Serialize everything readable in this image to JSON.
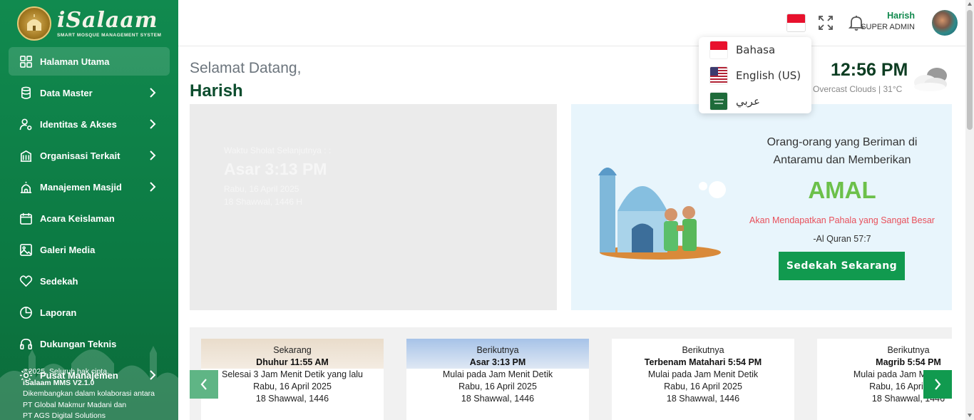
{
  "brand": {
    "name": "iSalaam",
    "subtitle": "SMART MOSQUE MANAGEMENT SYSTEM"
  },
  "sidebar": {
    "items": [
      {
        "label": "Halaman Utama",
        "icon": "grid-icon"
      },
      {
        "label": "Data Master",
        "icon": "database-icon"
      },
      {
        "label": "Identitas & Akses",
        "icon": "user-gear-icon"
      },
      {
        "label": "Organisasi Terkait",
        "icon": "building-icon"
      },
      {
        "label": "Manajemen Masjid",
        "icon": "mosque-icon"
      },
      {
        "label": "Acara Keislaman",
        "icon": "calendar-icon"
      },
      {
        "label": "Galeri Media",
        "icon": "image-icon"
      },
      {
        "label": "Sedekah",
        "icon": "heart-icon"
      },
      {
        "label": "Laporan",
        "icon": "pie-chart-icon"
      },
      {
        "label": "Dukungan Teknis",
        "icon": "headset-icon"
      },
      {
        "label": "Pusat Manajemen",
        "icon": "settings-icon"
      }
    ],
    "footer": {
      "copyright": "©2025. Seluruh hak cipta.",
      "version": "iSalaam MMS V2.1.0",
      "line1": "Dikembangkan dalam kolaborasi antara",
      "line2": "PT Global Makmur Madani dan",
      "line3": "PT AGS Digital Solutions"
    }
  },
  "topbar": {
    "user_name": "Harish",
    "user_role": "SUPER ADMIN"
  },
  "language_menu": {
    "options": [
      {
        "label": "Bahasa",
        "flag": "indonesia-flag-icon"
      },
      {
        "label": "English (US)",
        "flag": "us-flag-icon"
      },
      {
        "label": "عربي",
        "flag": "saudi-flag-icon"
      }
    ]
  },
  "welcome": {
    "greeting": "Selamat Datang,",
    "name": "Harish"
  },
  "weather": {
    "time": "12:56 PM",
    "condition": "Overcast Clouds | 31°C"
  },
  "next_prayer": {
    "label": "Waktu Sholat Selanjutnya : :",
    "time": "Asar 3:13 PM",
    "date": "Rabu, 16 April 2025",
    "hijri": "18 Shawwal, 1446 H"
  },
  "sedekah": {
    "line1": "Orang-orang yang Beriman di",
    "line2": "Antaramu dan Memberikan",
    "highlight": "AMAL",
    "subtitle": "Akan Mendapatkan Pahala yang Sangat Besar",
    "reference": "-Al Quran 57:7",
    "button": "Sedekah Sekarang"
  },
  "schedule": [
    {
      "status": "Sekarang",
      "name": "Dhuhur 11:55 AM",
      "desc": "Selesai 3 Jam Menit Detik yang lalu",
      "date": "Rabu, 16 April 2025",
      "hijri": "18 Shawwal, 1446"
    },
    {
      "status": "Berikutnya",
      "name": "Asar 3:13 PM",
      "desc": "Mulai pada Jam Menit Detik",
      "date": "Rabu, 16 April 2025",
      "hijri": "18 Shawwal, 1446"
    },
    {
      "status": "Berikutnya",
      "name": "Terbenam Matahari 5:54 PM",
      "desc": "Mulai pada Jam Menit Detik",
      "date": "Rabu, 16 April 2025",
      "hijri": "18 Shawwal, 1446"
    },
    {
      "status": "Berikutnya",
      "name": "Magrib 5:54 PM",
      "desc": "Mulai pada Jam Menit Detik",
      "date": "Rabu, 16 April 2025",
      "hijri": "18 Shawwal, 1446"
    }
  ],
  "colors": {
    "primary": "#119a4f",
    "sidebar": "#0c7a43",
    "accent_red": "#e8505b",
    "amal_green": "#6cc04a"
  }
}
